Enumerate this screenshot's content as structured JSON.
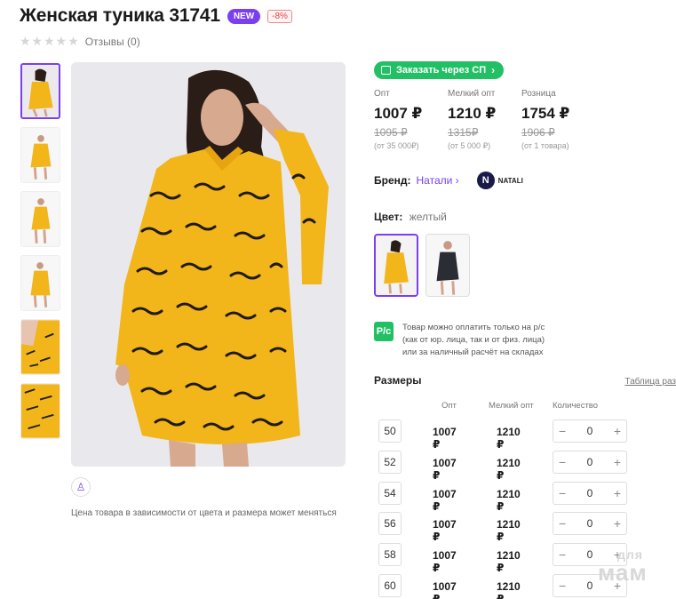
{
  "product": {
    "title": "Женская туника 31741",
    "badge_new": "NEW",
    "badge_discount": "-8%",
    "reviews": "Отзывы (0)",
    "rating_stars": 0,
    "price_note": "Цена товара в зависимости от цвета и размера может меняться"
  },
  "order_button": {
    "label": "Заказать через СП"
  },
  "prices": [
    {
      "label": "Опт",
      "value": "1007 ₽",
      "old": "1095 ₽",
      "condition": "(от 35 000₽)"
    },
    {
      "label": "Мелкий опт",
      "value": "1210 ₽",
      "old": "1315₽",
      "condition": "(от 5 000 ₽)"
    },
    {
      "label": "Розница",
      "value": "1754 ₽",
      "old": "1906 ₽",
      "condition": "(от 1 товара)"
    }
  ],
  "brand": {
    "label": "Бренд:",
    "name": "Натали",
    "logo_text": "NATALI",
    "logo_letter": "N"
  },
  "color": {
    "label": "Цвет:",
    "value": "желтый"
  },
  "payment_note": {
    "icon_text": "P/c",
    "line1": "Товар можно оплатить только на р/с",
    "line2": "(как от юр. лица, так и от физ. лица)",
    "line3": "или за наличный расчёт на складах"
  },
  "sizes": {
    "label": "Размеры",
    "table_link": "Таблица раз",
    "headers": {
      "opt": "Опт",
      "small_opt": "Мелкий опт",
      "qty": "Количество"
    },
    "rows": [
      {
        "size": "50",
        "opt": "1007 ₽",
        "small_opt": "1210 ₽",
        "qty": "0"
      },
      {
        "size": "52",
        "opt": "1007 ₽",
        "small_opt": "1210 ₽",
        "qty": "0"
      },
      {
        "size": "54",
        "opt": "1007 ₽",
        "small_opt": "1210 ₽",
        "qty": "0"
      },
      {
        "size": "56",
        "opt": "1007 ₽",
        "small_opt": "1210 ₽",
        "qty": "0"
      },
      {
        "size": "58",
        "opt": "1007 ₽",
        "small_opt": "1210 ₽",
        "qty": "0"
      },
      {
        "size": "60",
        "opt": "1007 ₽",
        "small_opt": "1210 ₽",
        "qty": "0"
      }
    ],
    "minus": "−",
    "plus": "+"
  },
  "watermark": {
    "line1": "для",
    "line2": "мам"
  },
  "colors": {
    "accent": "#7a3ff2",
    "green": "#22c064",
    "dress_yellow": "#f2b51a"
  }
}
